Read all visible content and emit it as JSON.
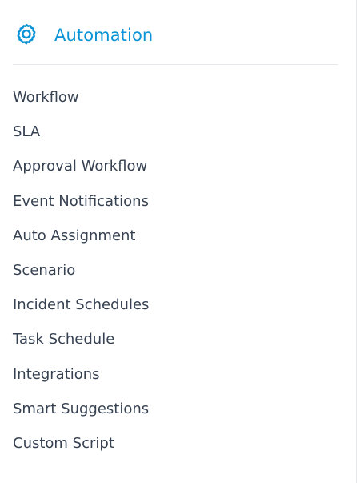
{
  "header": {
    "title": "Automation",
    "icon": "gear-icon",
    "accent_color": "#0a93d6"
  },
  "menu": {
    "items": [
      {
        "label": "Workflow"
      },
      {
        "label": "SLA"
      },
      {
        "label": "Approval Workflow"
      },
      {
        "label": "Event Notifications"
      },
      {
        "label": "Auto Assignment"
      },
      {
        "label": "Scenario"
      },
      {
        "label": "Incident Schedules"
      },
      {
        "label": "Task Schedule"
      },
      {
        "label": "Integrations"
      },
      {
        "label": "Smart Suggestions"
      },
      {
        "label": "Custom Script"
      }
    ],
    "text_color": "#364152"
  }
}
